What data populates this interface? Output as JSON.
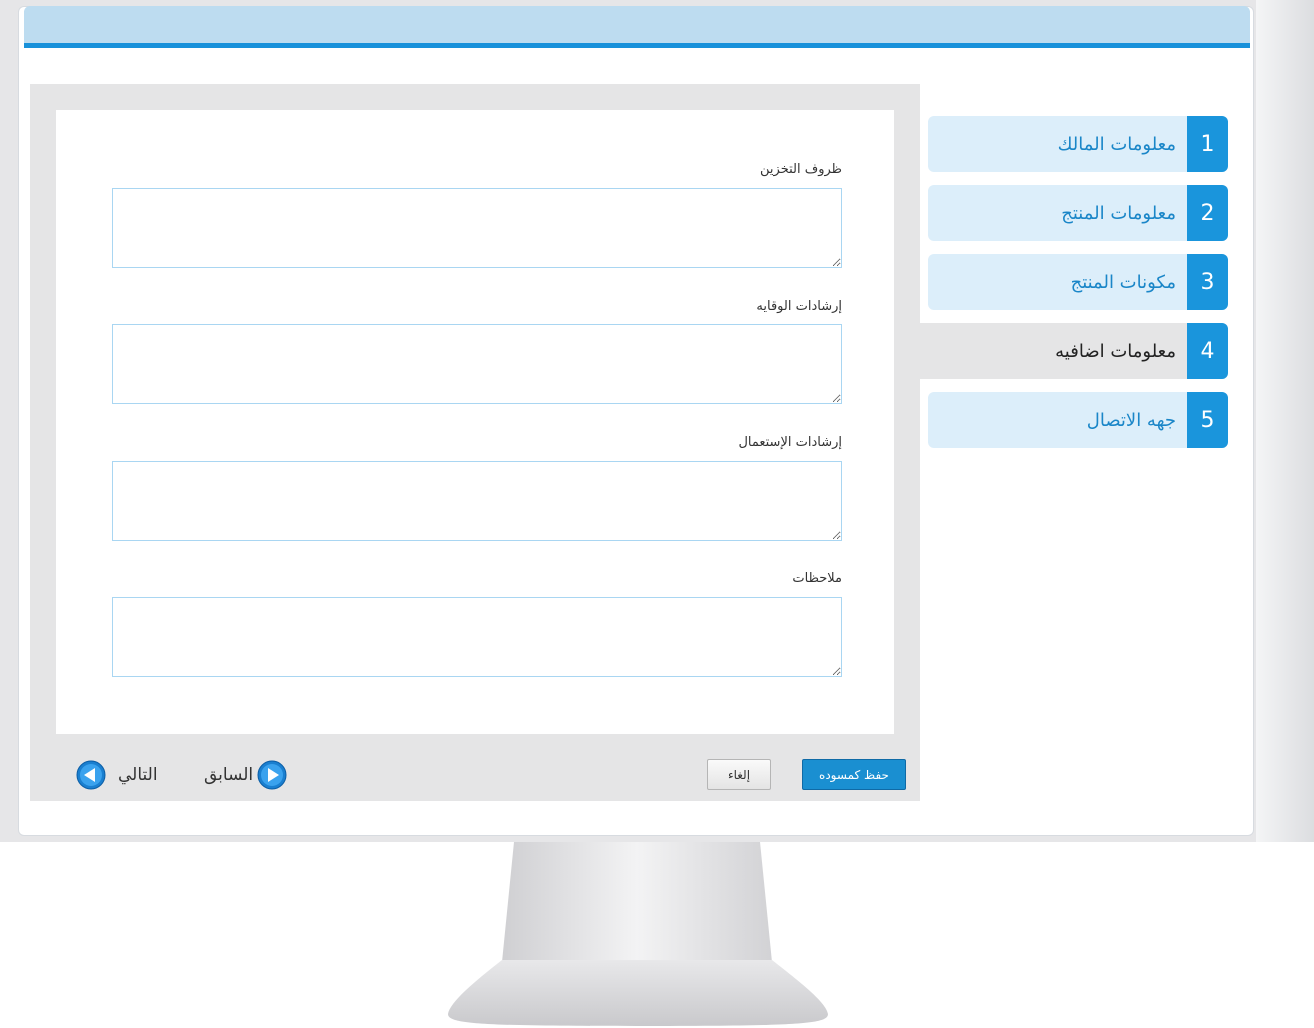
{
  "steps": [
    {
      "num": "1",
      "label": "معلومات المالك",
      "active": false
    },
    {
      "num": "2",
      "label": "معلومات المنتج",
      "active": false
    },
    {
      "num": "3",
      "label": "مكونات المنتج",
      "active": false
    },
    {
      "num": "4",
      "label": "معلومات اضافيه",
      "active": true
    },
    {
      "num": "5",
      "label": "جهه الاتصال",
      "active": false
    }
  ],
  "fields": {
    "storage": {
      "label": "ظروف التخزين",
      "value": ""
    },
    "safety": {
      "label": "إرشادات الوقايه",
      "value": ""
    },
    "usage": {
      "label": "إرشادات الإستعمال",
      "value": ""
    },
    "notes": {
      "label": "ملاحظات",
      "value": ""
    }
  },
  "actions": {
    "save_draft": "حفظ كمسوده",
    "cancel": "إلغاء",
    "previous": "السابق",
    "next": "التالي"
  },
  "colors": {
    "accent": "#1a95dc",
    "step_bg": "#dceefa",
    "panel_bg": "#e5e5e6",
    "banner": "#bddcf0"
  }
}
